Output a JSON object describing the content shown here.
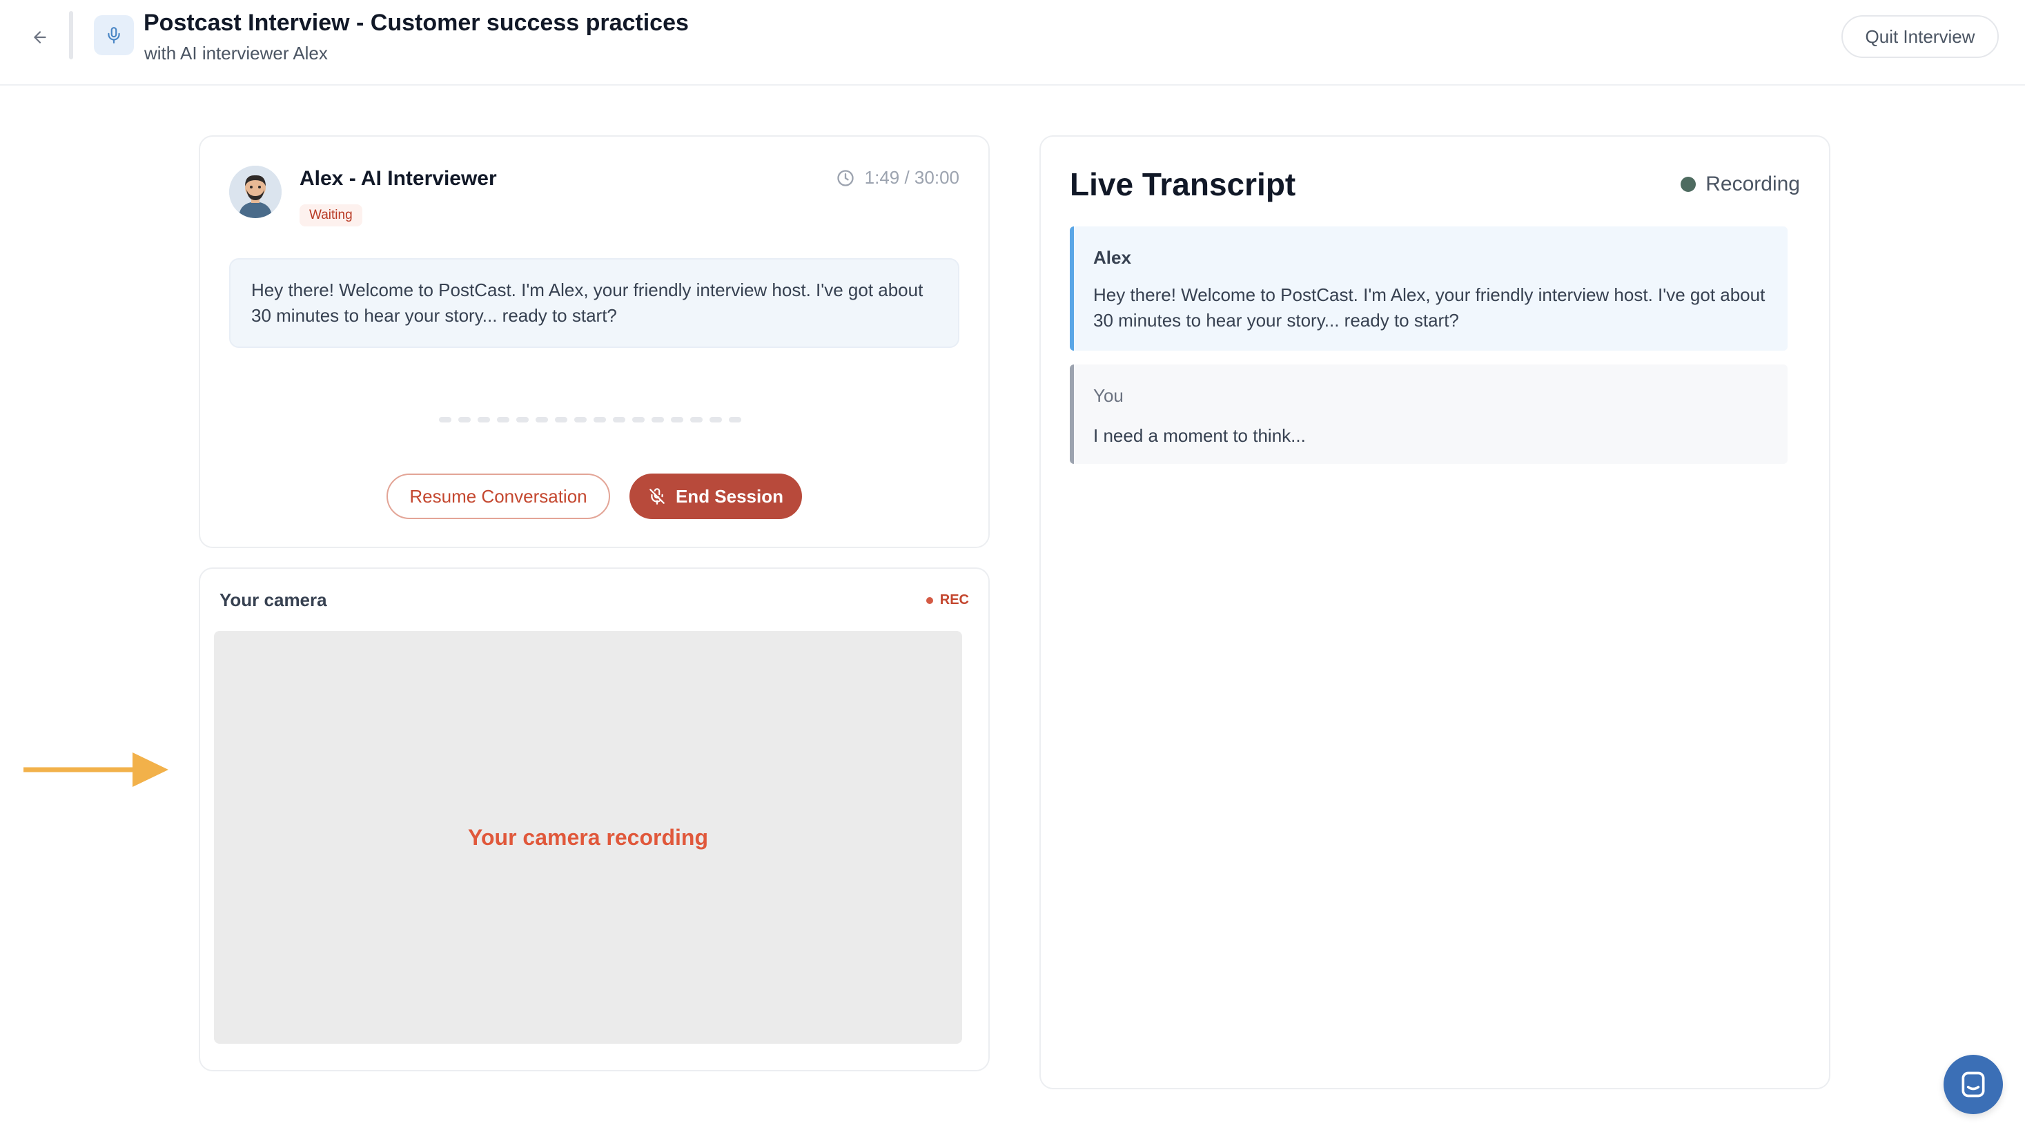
{
  "header": {
    "title": "Postcast Interview - Customer success practices",
    "subtitle": "with AI interviewer Alex",
    "quit_label": "Quit Interview"
  },
  "ai_panel": {
    "name": "Alex - AI Interviewer",
    "status": "Waiting",
    "timer": "1:49 / 30:00",
    "message": "Hey there! Welcome to PostCast. I'm Alex, your friendly interview host. I've got about 30 minutes to hear your story... ready to start?",
    "resume_label": "Resume Conversation",
    "end_label": "End Session"
  },
  "camera": {
    "label": "Your camera",
    "rec_label": "REC",
    "placeholder": "Your camera recording"
  },
  "transcript": {
    "title": "Live Transcript",
    "status": "Recording",
    "entries": [
      {
        "speaker": "Alex",
        "text": "Hey there! Welcome to PostCast. I'm Alex, your friendly interview host. I've got about 30 minutes to hear your story... ready to start?"
      },
      {
        "speaker": "You",
        "text": "I need a moment to think..."
      }
    ]
  },
  "colors": {
    "accent_red": "#b84a3b",
    "status_green": "#4e6b60",
    "alex_bar": "#5aa6e6",
    "arrow": "#f2b14a",
    "chat_fab": "#3b6fb6"
  },
  "icons": [
    "back-arrow-icon",
    "microphone-icon",
    "clock-icon",
    "mic-off-icon",
    "chat-icon",
    "pointer-arrow-icon"
  ]
}
